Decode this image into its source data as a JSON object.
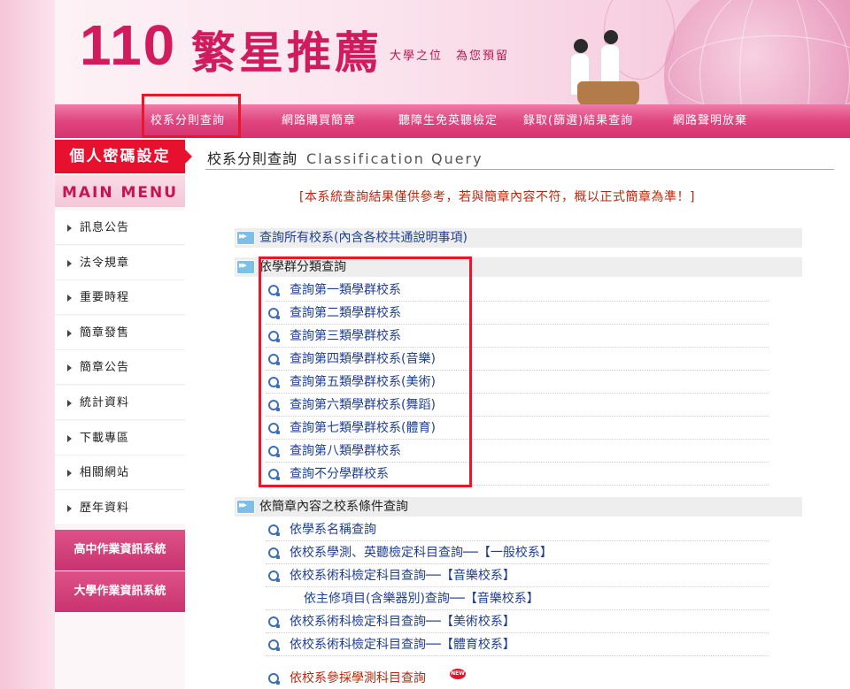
{
  "header": {
    "title_number": "110",
    "title_text": "繁星推薦",
    "slogan": "大學之位　為您預留"
  },
  "nav": {
    "items": [
      "校系分則查詢",
      "網路購買簡章",
      "聽障生免英聽檢定",
      "錄取(篩選)結果查詢",
      "網路聲明放棄"
    ]
  },
  "sidebar": {
    "password_button": "個人密碼設定",
    "main_menu_label": "MAIN MENU",
    "items": [
      "訊息公告",
      "法令規章",
      "重要時程",
      "簡章發售",
      "簡章公告",
      "統計資料",
      "下載專區",
      "相關網站",
      "歷年資料"
    ],
    "systems": [
      "高中作業資訊系統",
      "大學作業資訊系統"
    ]
  },
  "main": {
    "title": "校系分則查詢",
    "title_en": "Classification Query",
    "notice": "[本系統查詢結果僅供參考，若與簡章內容不符，概以正式簡章為準！]",
    "section_all": "查詢所有校系(內含各校共通說明事項)",
    "section_group": "依學群分類查詢",
    "group_links": [
      "查詢第一類學群校系",
      "查詢第二類學群校系",
      "查詢第三類學群校系",
      "查詢第四類學群校系(音樂)",
      "查詢第五類學群校系(美術)",
      "查詢第六類學群校系(舞蹈)",
      "查詢第七類學群校系(體育)",
      "查詢第八類學群校系",
      "查詢不分學群校系"
    ],
    "section_conditions": "依簡章內容之校系條件查詢",
    "condition_links": [
      "依學系名稱查詢",
      "依校系學測、英聽檢定科目查詢──【一般校系】",
      "依校系術科檢定科目查詢──【音樂校系】",
      "依主修項目(含樂器別)查詢──【音樂校系】",
      "依校系術科檢定科目查詢──【美術校系】",
      "依校系術科檢定科目查詢──【體育校系】",
      "依校系參採學測科目查詢"
    ],
    "new_badge": "NEW"
  },
  "colors": {
    "brand_pink": "#d21b5c",
    "nav_pink": "#e0457f",
    "highlight_red": "#e8182c",
    "link_blue": "#1f3f95"
  }
}
